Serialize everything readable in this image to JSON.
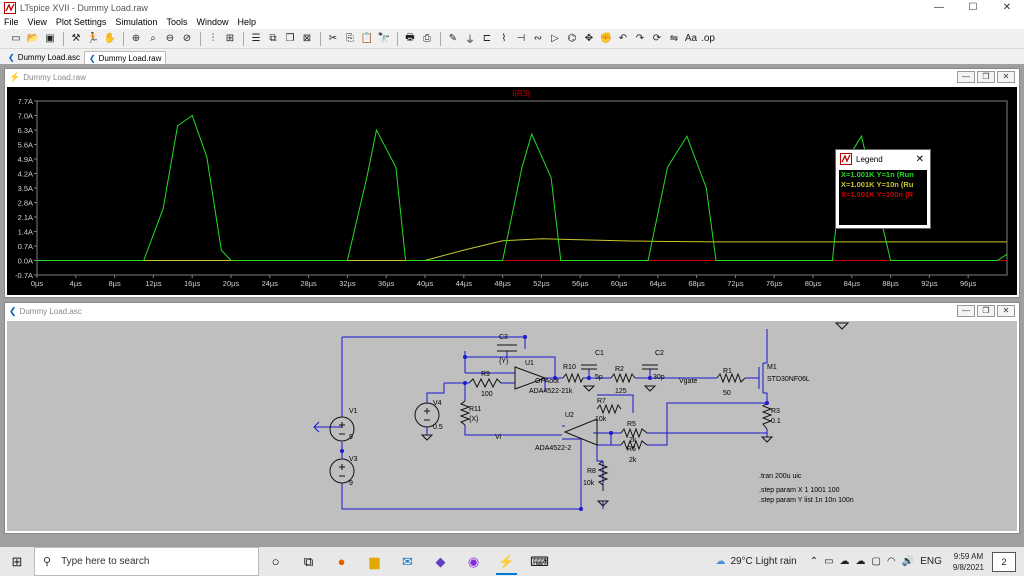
{
  "window": {
    "title": "LTspice XVII - Dummy Load.raw",
    "icon": "ltspice-icon"
  },
  "window_controls": {
    "minimize": "—",
    "maximize": "☐",
    "close": "✕"
  },
  "menu": [
    "File",
    "View",
    "Plot Settings",
    "Simulation",
    "Tools",
    "Window",
    "Help"
  ],
  "tabs": [
    {
      "label": "Dummy Load.asc",
      "active": false
    },
    {
      "label": "Dummy Load.raw",
      "active": true
    }
  ],
  "waveform_window": {
    "title": "Dummy Load.raw",
    "trace_label": "I(R3)",
    "chart_data": {
      "type": "line",
      "title": "I(R3)",
      "xlabel": "",
      "ylabel": "",
      "x_ticks": [
        "0µs",
        "4µs",
        "8µs",
        "12µs",
        "16µs",
        "20µs",
        "24µs",
        "28µs",
        "32µs",
        "36µs",
        "40µs",
        "44µs",
        "48µs",
        "52µs",
        "56µs",
        "60µs",
        "64µs",
        "68µs",
        "72µs",
        "76µs",
        "80µs",
        "84µs",
        "88µs",
        "92µs",
        "96µs"
      ],
      "y_ticks": [
        "7.7A",
        "7.0A",
        "6.3A",
        "5.6A",
        "4.9A",
        "4.2A",
        "3.5A",
        "2.8A",
        "2.1A",
        "1.4A",
        "0.7A",
        "0.0A",
        "-0.7A"
      ],
      "xlim": [
        0,
        100
      ],
      "ylim": [
        -0.7,
        7.7
      ],
      "series": [
        {
          "color": "#22dd22",
          "x": [
            0,
            11,
            13,
            14.5,
            16,
            17.5,
            19,
            20,
            32,
            34,
            35,
            37,
            38,
            48,
            50,
            51,
            53,
            54,
            63,
            65,
            67,
            69,
            70,
            82,
            83,
            85,
            86,
            88,
            89,
            99,
            100
          ],
          "y": [
            0,
            0,
            2.5,
            6.5,
            7.0,
            5.0,
            0.5,
            0,
            0,
            4.0,
            6.3,
            4.5,
            0,
            0,
            4.5,
            6.1,
            4.0,
            0,
            0,
            4.5,
            6.0,
            3.5,
            0,
            0,
            4.5,
            6.0,
            4.0,
            0,
            0,
            0,
            0.3
          ]
        },
        {
          "color": "#c8c830",
          "x": [
            0,
            40,
            44,
            48,
            52,
            56,
            60,
            64,
            70,
            80,
            90,
            100
          ],
          "y": [
            0,
            0,
            0.5,
            0.95,
            1.05,
            1.0,
            0.95,
            0.92,
            0.9,
            0.9,
            0.9,
            0.9
          ]
        },
        {
          "color": "#cc0000",
          "x": [
            0,
            100
          ],
          "y": [
            0,
            0
          ]
        }
      ]
    }
  },
  "legend": {
    "title": "Legend",
    "close": "✕",
    "rows": [
      {
        "text": "X=1.001K Y=1n  (Run",
        "color": "#22dd22"
      },
      {
        "text": "X=1.001K Y=10n  (Ru",
        "color": "#c8c830"
      },
      {
        "text": "X=1.001K Y=100n  (R",
        "color": "#cc0000"
      }
    ]
  },
  "schematic_window": {
    "title": "Dummy Load.asc",
    "labels": {
      "c3": "C3",
      "c3v": "{Y}",
      "u1": "U1",
      "u1p": "ADA4522-2",
      "opaout": "OPAout",
      "r9": "R9",
      "r9v": "100",
      "r10": "R10",
      "r10v": "1k",
      "c1": "C1",
      "c1v": "5p",
      "r2": "R2",
      "r2v": "125",
      "c2": "C2",
      "c2v": "30p",
      "vgate": "Vgate",
      "r1": "R1",
      "r1v": "50",
      "m1": "M1",
      "m1p": "STD30NF06L",
      "r3": "R3",
      "r3v": "0.1",
      "v4": "V4",
      "v4v": "0.5",
      "r11": "R11",
      "r11v": "{X}",
      "vi": "Vi",
      "r7": "R7",
      "r7v": "10k",
      "u2": "U2",
      "u2p": "ADA4522-2",
      "r5": "R5",
      "r5v": "2k",
      "r6": "R6",
      "r6v": "2k",
      "r8": "R8",
      "r8v": "10k",
      "v1": "V1",
      "v1v": "9",
      "v3": "V3",
      "v3v": "9",
      "tran": ".tran 200u uic",
      "step1": ".step param X 1 1001 100",
      "step2": ".step param Y list 1n 10n 100n"
    }
  },
  "taskbar": {
    "search_placeholder": "Type here to search",
    "weather": "29°C  Light rain",
    "lang": "ENG",
    "time": "9:59 AM",
    "date": "9/8/2021",
    "notifications": "2"
  }
}
